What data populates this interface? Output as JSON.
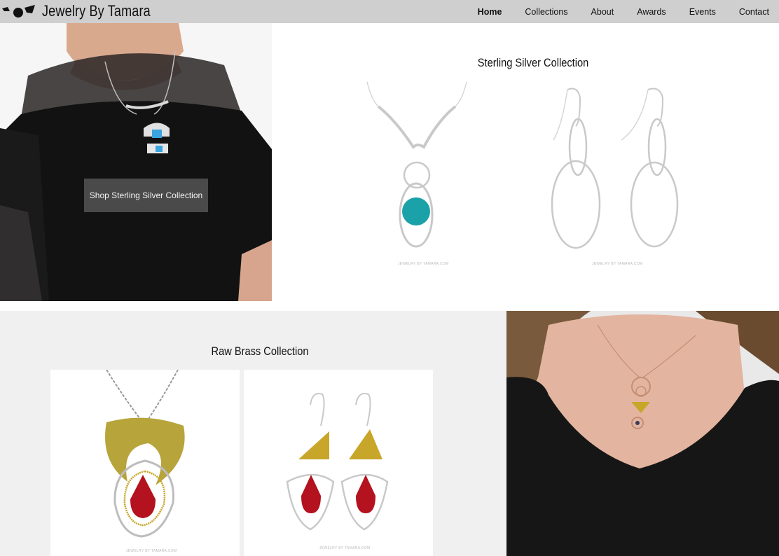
{
  "header": {
    "brand": "Jewelry By Tamara",
    "nav": [
      {
        "label": "Home",
        "active": true
      },
      {
        "label": "Collections"
      },
      {
        "label": "About"
      },
      {
        "label": "Awards"
      },
      {
        "label": "Events"
      },
      {
        "label": "Contact"
      }
    ]
  },
  "hero_sterling": {
    "button_label": "Shop Sterling Silver Collection"
  },
  "sterling": {
    "title": "Sterling Silver Collection",
    "watermark": "JEWELRY BY TAMARA.COM"
  },
  "brass": {
    "title": "Raw Brass Collection",
    "watermark": "JEWELRY BY TAMARA.COM"
  },
  "colors": {
    "topbar": "#cfcfcf",
    "button_bg": "#4a4a4a",
    "section_gray": "#f0f0f0",
    "turquoise": "#1aa2a8",
    "garnet": "#b3121e",
    "brass": "#c8a62a"
  }
}
